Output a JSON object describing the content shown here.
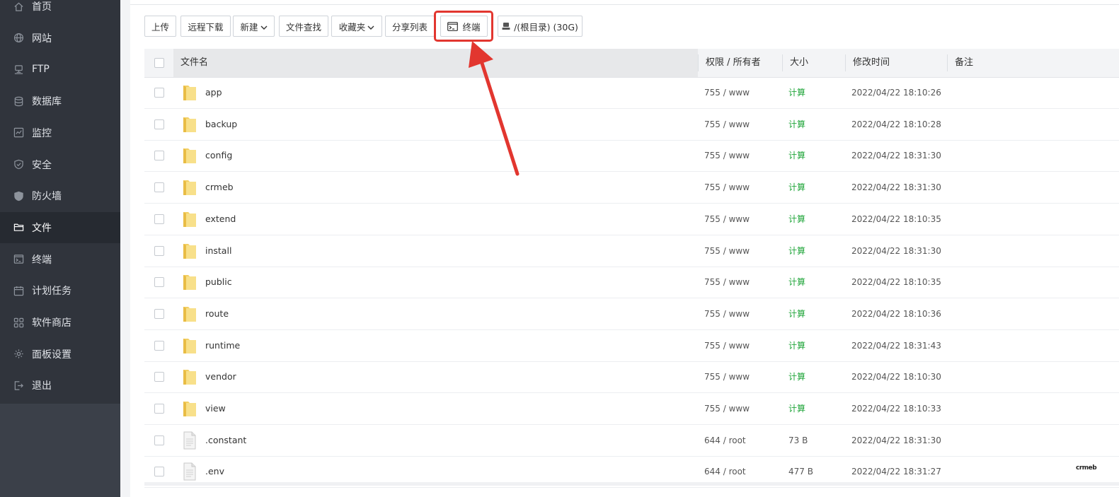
{
  "sidebar": {
    "items": [
      {
        "label": "首页",
        "icon": "home-icon"
      },
      {
        "label": "网站",
        "icon": "globe-icon"
      },
      {
        "label": "FTP",
        "icon": "ftp-icon"
      },
      {
        "label": "数据库",
        "icon": "database-icon"
      },
      {
        "label": "监控",
        "icon": "monitor-icon"
      },
      {
        "label": "安全",
        "icon": "shield-icon"
      },
      {
        "label": "防火墙",
        "icon": "firewall-icon"
      },
      {
        "label": "文件",
        "icon": "folder-icon",
        "active": true
      },
      {
        "label": "终端",
        "icon": "terminal-icon"
      },
      {
        "label": "计划任务",
        "icon": "calendar-icon"
      },
      {
        "label": "软件商店",
        "icon": "apps-icon"
      },
      {
        "label": "面板设置",
        "icon": "gear-icon"
      },
      {
        "label": "退出",
        "icon": "logout-icon"
      }
    ]
  },
  "toolbar": {
    "upload": "上传",
    "remote_download": "远程下载",
    "new": "新建",
    "file_search": "文件查找",
    "favorites": "收藏夹",
    "share_list": "分享列表",
    "terminal": "终端",
    "disk": "/(根目录) (30G)"
  },
  "table": {
    "headers": {
      "name": "文件名",
      "perm": "权限 / 所有者",
      "size": "大小",
      "mtime": "修改时间",
      "note": "备注"
    },
    "rows": [
      {
        "name": "app",
        "type": "folder",
        "perm": "755 / www",
        "size": "计算",
        "mtime": "2022/04/22 18:10:26"
      },
      {
        "name": "backup",
        "type": "folder",
        "perm": "755 / www",
        "size": "计算",
        "mtime": "2022/04/22 18:10:28"
      },
      {
        "name": "config",
        "type": "folder",
        "perm": "755 / www",
        "size": "计算",
        "mtime": "2022/04/22 18:31:30"
      },
      {
        "name": "crmeb",
        "type": "folder",
        "perm": "755 / www",
        "size": "计算",
        "mtime": "2022/04/22 18:31:30"
      },
      {
        "name": "extend",
        "type": "folder",
        "perm": "755 / www",
        "size": "计算",
        "mtime": "2022/04/22 18:10:35"
      },
      {
        "name": "install",
        "type": "folder",
        "perm": "755 / www",
        "size": "计算",
        "mtime": "2022/04/22 18:31:30"
      },
      {
        "name": "public",
        "type": "folder",
        "perm": "755 / www",
        "size": "计算",
        "mtime": "2022/04/22 18:10:35"
      },
      {
        "name": "route",
        "type": "folder",
        "perm": "755 / www",
        "size": "计算",
        "mtime": "2022/04/22 18:10:36"
      },
      {
        "name": "runtime",
        "type": "folder",
        "perm": "755 / www",
        "size": "计算",
        "mtime": "2022/04/22 18:31:43"
      },
      {
        "name": "vendor",
        "type": "folder",
        "perm": "755 / www",
        "size": "计算",
        "mtime": "2022/04/22 18:10:30"
      },
      {
        "name": "view",
        "type": "folder",
        "perm": "755 / www",
        "size": "计算",
        "mtime": "2022/04/22 18:10:33"
      },
      {
        "name": ".constant",
        "type": "file",
        "perm": "644 / root",
        "size": "73 B",
        "mtime": "2022/04/22 18:31:30"
      },
      {
        "name": ".env",
        "type": "file",
        "perm": "644 / root",
        "size": "477 B",
        "mtime": "2022/04/22 18:31:27"
      }
    ]
  },
  "watermark": "crmeb",
  "colors": {
    "accent_green": "#20a53a",
    "highlight_red": "#e2362f",
    "sidebar_bg": "#30343c"
  }
}
